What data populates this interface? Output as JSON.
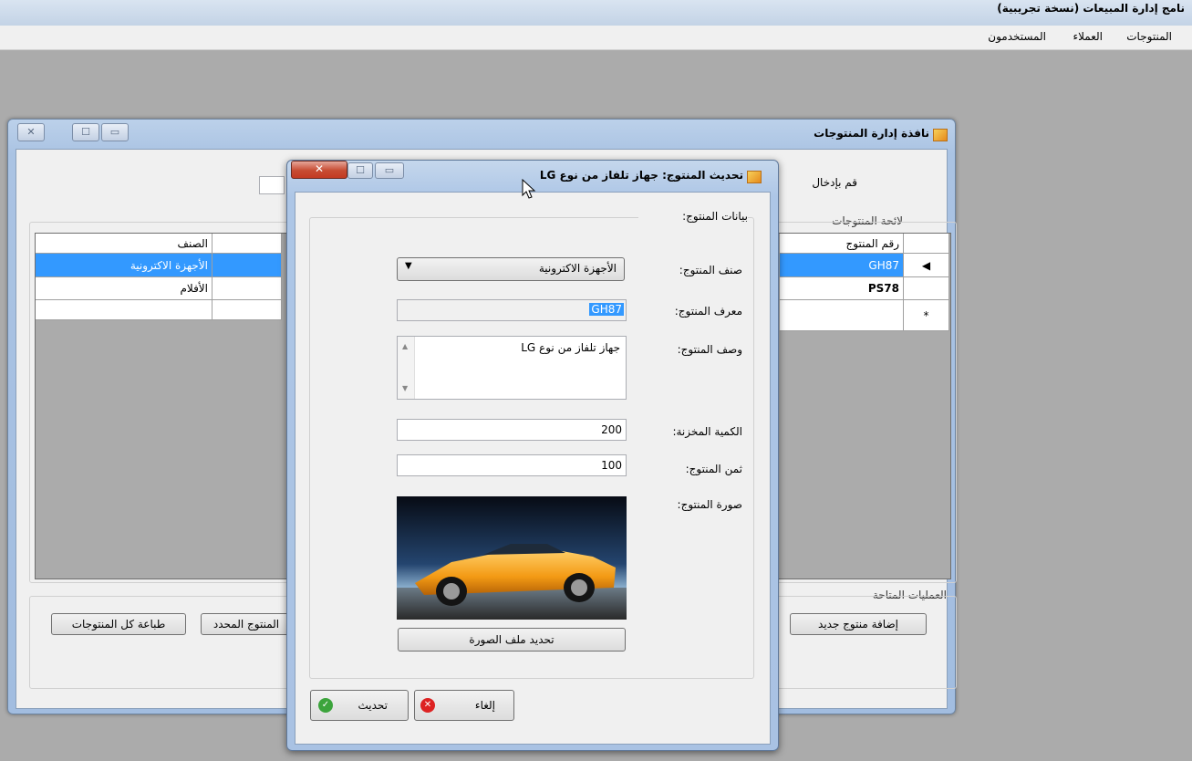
{
  "app": {
    "title": "نامج إدارة المبيعات (نسخة تجريبية)",
    "menu": [
      "المنتوجات",
      "العملاء",
      "المستخدمون"
    ]
  },
  "product_window": {
    "title": "نافذة إدارة المنتوجات",
    "search_prompt": "قم بإدخال",
    "list_group": "لائحة المنتوجات",
    "columns": {
      "product_number": "رقم المنتوج",
      "category": "الصنف"
    },
    "rows": [
      {
        "number": "GH87",
        "category": "الأجهزة الاكترونية"
      },
      {
        "number": "PS78",
        "category": "الأفلام"
      }
    ],
    "new_row_marker": "*",
    "ops_group": "العمليات المتاحة",
    "buttons": {
      "add": "إضافة منتوج جديد",
      "print_selected": "المنتوج المحدد",
      "print_all": "طباعة كل المنتوجات"
    }
  },
  "dialog": {
    "title": "تحديث المنتوج: جهاز تلفاز من نوع LG",
    "group": "بيانات المنتوج:",
    "labels": {
      "category": "صنف المنتوج:",
      "id": "معرف المنتوج:",
      "description": "وصف المنتوج:",
      "quantity": "الكمية المخزنة:",
      "price": "ثمن المنتوج:",
      "image": "صورة المنتوج:"
    },
    "values": {
      "category": "الأجهزة الاكترونية",
      "id": "GH87",
      "description": "جهاز تلفاز من نوع LG",
      "quantity": "200",
      "price": "100"
    },
    "buttons": {
      "choose_image": "تحديد ملف الصورة",
      "cancel": "إلغاء",
      "update": "تحديث"
    }
  },
  "colors": {
    "selection": "#3399ff",
    "close_button": "#c74b32"
  }
}
